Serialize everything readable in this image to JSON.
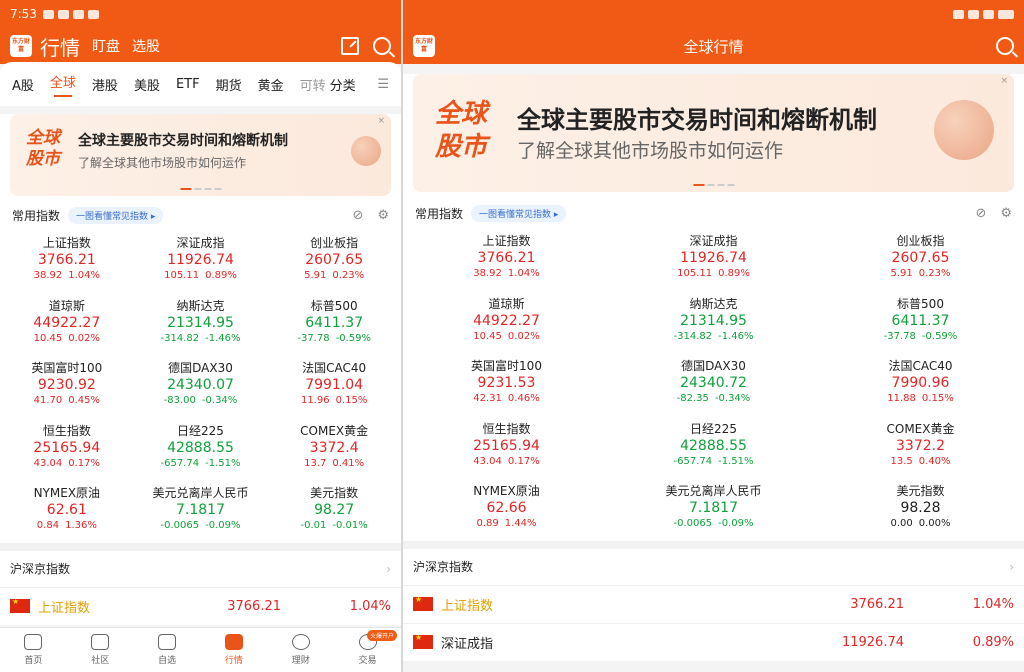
{
  "left": {
    "status": {
      "time": "7:53"
    },
    "header": {
      "title": "行情",
      "tabs": [
        "盯盘",
        "选股"
      ],
      "logo": "东方财富"
    },
    "market_tabs": [
      "A股",
      "全球",
      "港股",
      "美股",
      "ETF",
      "期货",
      "黄金",
      "可转",
      "分类"
    ],
    "active_tab": "全球",
    "banner": {
      "tag1": "全球",
      "tag2": "股市",
      "title": "全球主要股市交易时间和熔断机制",
      "subtitle": "了解全球其他市场股市如何运作",
      "close": "×"
    },
    "indices_section": {
      "title": "常用指数",
      "pill": "一图看懂常见指数 ▸"
    },
    "indices": [
      {
        "name": "上证指数",
        "price": "3766.21",
        "chg": "38.92",
        "pct": "1.04%",
        "dir": "up"
      },
      {
        "name": "深证成指",
        "price": "11926.74",
        "chg": "105.11",
        "pct": "0.89%",
        "dir": "up"
      },
      {
        "name": "创业板指",
        "price": "2607.65",
        "chg": "5.91",
        "pct": "0.23%",
        "dir": "up"
      },
      {
        "name": "道琼斯",
        "price": "44922.27",
        "chg": "10.45",
        "pct": "0.02%",
        "dir": "up"
      },
      {
        "name": "纳斯达克",
        "price": "21314.95",
        "chg": "-314.82",
        "pct": "-1.46%",
        "dir": "down"
      },
      {
        "name": "标普500",
        "price": "6411.37",
        "chg": "-37.78",
        "pct": "-0.59%",
        "dir": "down"
      },
      {
        "name": "英国富时100",
        "price": "9230.92",
        "chg": "41.70",
        "pct": "0.45%",
        "dir": "up"
      },
      {
        "name": "德国DAX30",
        "price": "24340.07",
        "chg": "-83.00",
        "pct": "-0.34%",
        "dir": "down"
      },
      {
        "name": "法国CAC40",
        "price": "7991.04",
        "chg": "11.96",
        "pct": "0.15%",
        "dir": "up"
      },
      {
        "name": "恒生指数",
        "price": "25165.94",
        "chg": "43.04",
        "pct": "0.17%",
        "dir": "up"
      },
      {
        "name": "日经225",
        "price": "42888.55",
        "chg": "-657.74",
        "pct": "-1.51%",
        "dir": "down"
      },
      {
        "name": "COMEX黄金",
        "price": "3372.4",
        "chg": "13.7",
        "pct": "0.41%",
        "dir": "up"
      },
      {
        "name": "NYMEX原油",
        "price": "62.61",
        "chg": "0.84",
        "pct": "1.36%",
        "dir": "up"
      },
      {
        "name": "美元兑离岸人民币",
        "price": "7.1817",
        "chg": "-0.0065",
        "pct": "-0.09%",
        "dir": "down"
      },
      {
        "name": "美元指数",
        "price": "98.27",
        "chg": "-0.01",
        "pct": "-0.01%",
        "dir": "down"
      }
    ],
    "list_section": {
      "title": "沪深京指数"
    },
    "list": [
      {
        "name": "上证指数",
        "value": "3766.21",
        "pct": "1.04%"
      }
    ],
    "bottom_nav": [
      {
        "label": "首页"
      },
      {
        "label": "社区"
      },
      {
        "label": "自选"
      },
      {
        "label": "行情"
      },
      {
        "label": "理财"
      },
      {
        "label": "交易"
      }
    ],
    "badge": "火爆开户"
  },
  "right": {
    "header": {
      "title": "全球行情"
    },
    "banner": {
      "tag1": "全球",
      "tag2": "股市",
      "title": "全球主要股市交易时间和熔断机制",
      "subtitle": "了解全球其他市场股市如何运作",
      "close": "×"
    },
    "indices_section": {
      "title": "常用指数",
      "pill": "一图看懂常见指数 ▸"
    },
    "indices": [
      {
        "name": "上证指数",
        "price": "3766.21",
        "chg": "38.92",
        "pct": "1.04%",
        "dir": "up"
      },
      {
        "name": "深证成指",
        "price": "11926.74",
        "chg": "105.11",
        "pct": "0.89%",
        "dir": "up"
      },
      {
        "name": "创业板指",
        "price": "2607.65",
        "chg": "5.91",
        "pct": "0.23%",
        "dir": "up"
      },
      {
        "name": "道琼斯",
        "price": "44922.27",
        "chg": "10.45",
        "pct": "0.02%",
        "dir": "up"
      },
      {
        "name": "纳斯达克",
        "price": "21314.95",
        "chg": "-314.82",
        "pct": "-1.46%",
        "dir": "down"
      },
      {
        "name": "标普500",
        "price": "6411.37",
        "chg": "-37.78",
        "pct": "-0.59%",
        "dir": "down"
      },
      {
        "name": "英国富时100",
        "price": "9231.53",
        "chg": "42.31",
        "pct": "0.46%",
        "dir": "up"
      },
      {
        "name": "德国DAX30",
        "price": "24340.72",
        "chg": "-82.35",
        "pct": "-0.34%",
        "dir": "down"
      },
      {
        "name": "法国CAC40",
        "price": "7990.96",
        "chg": "11.88",
        "pct": "0.15%",
        "dir": "up"
      },
      {
        "name": "恒生指数",
        "price": "25165.94",
        "chg": "43.04",
        "pct": "0.17%",
        "dir": "up"
      },
      {
        "name": "日经225",
        "price": "42888.55",
        "chg": "-657.74",
        "pct": "-1.51%",
        "dir": "down"
      },
      {
        "name": "COMEX黄金",
        "price": "3372.2",
        "chg": "13.5",
        "pct": "0.40%",
        "dir": "up"
      },
      {
        "name": "NYMEX原油",
        "price": "62.66",
        "chg": "0.89",
        "pct": "1.44%",
        "dir": "up"
      },
      {
        "name": "美元兑离岸人民币",
        "price": "7.1817",
        "chg": "-0.0065",
        "pct": "-0.09%",
        "dir": "down"
      },
      {
        "name": "美元指数",
        "price": "98.28",
        "chg": "0.00",
        "pct": "0.00%",
        "dir": "flat"
      }
    ],
    "list_section": {
      "title": "沪深京指数"
    },
    "list": [
      {
        "name": "上证指数",
        "value": "3766.21",
        "pct": "1.04%",
        "highlight": true
      },
      {
        "name": "深证成指",
        "value": "11926.74",
        "pct": "0.89%",
        "highlight": false
      }
    ]
  },
  "colors": {
    "brand": "#f05a14",
    "up": "#e02626",
    "down": "#0fa13b"
  }
}
